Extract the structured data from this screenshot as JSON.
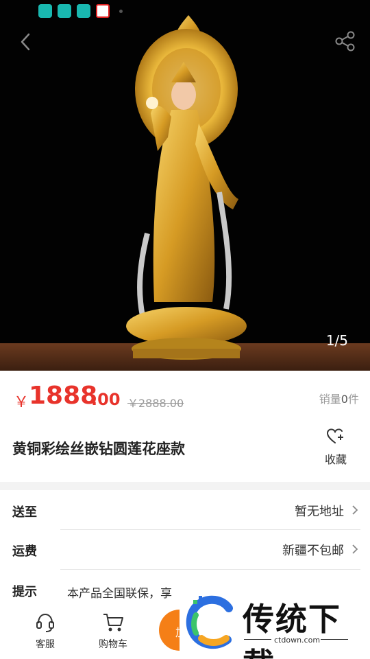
{
  "gallery": {
    "counter": "1/5"
  },
  "product": {
    "currency": "￥",
    "price_int": "1888",
    "price_dec": ".00",
    "original_price": "￥2888.00",
    "sales_prefix": "销量",
    "sales_count": "0",
    "sales_suffix": "件",
    "title": "黄铜彩绘丝嵌钻圆莲花座款",
    "favorite_label": "收藏"
  },
  "info_rows": [
    {
      "label": "送至",
      "value": "暂无地址"
    },
    {
      "label": "运费",
      "value": "新疆不包邮"
    },
    {
      "label": "提示",
      "value": "本产品全国联保，享"
    }
  ],
  "bottom_bar": {
    "service_label": "客服",
    "cart_label": "购物车",
    "buy_label": "加"
  },
  "watermark": {
    "brand": "传统下载",
    "url": "ctdown.com"
  },
  "colors": {
    "price_red": "#e8332b",
    "action_orange": "#f57f17",
    "status_icon_teal": "#19b8b0"
  }
}
